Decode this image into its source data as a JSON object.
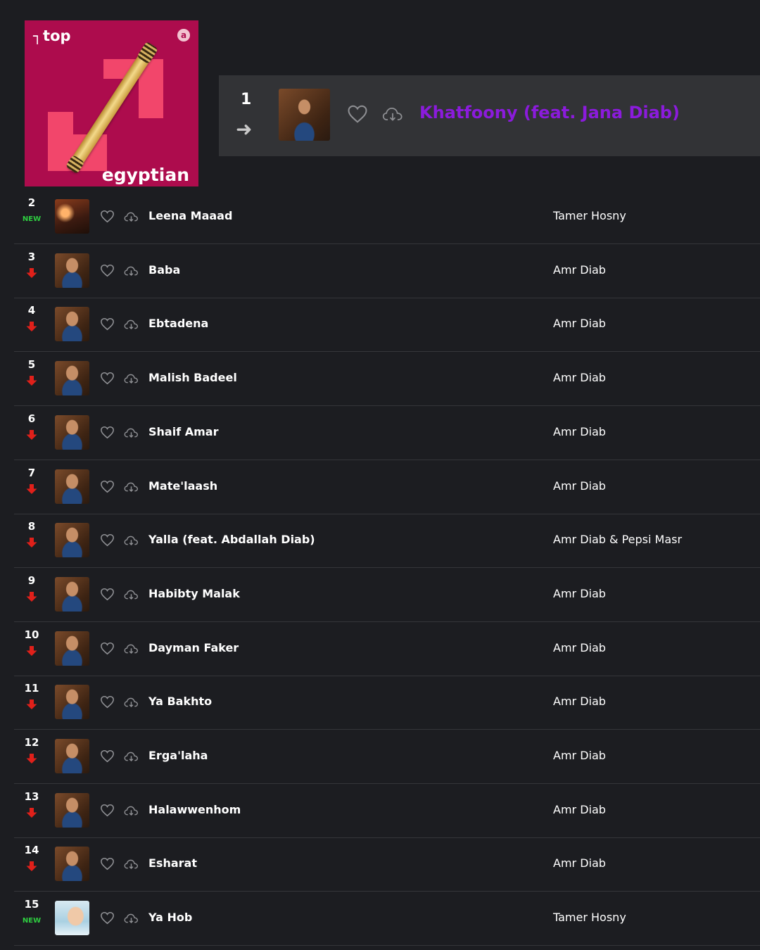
{
  "cover": {
    "brand": "top",
    "subtitle": "egyptian"
  },
  "featured": {
    "rank": "1",
    "trend": "same",
    "title": "Khatfoony (feat. Jana Diab)",
    "title_color": "#8b1bdc"
  },
  "tracks": [
    {
      "rank": "2",
      "status": "NEW",
      "title": "Leena Maaad",
      "artist": "Tamer Hosny"
    },
    {
      "rank": "3",
      "status": "down",
      "title": "Baba",
      "artist": "Amr Diab"
    },
    {
      "rank": "4",
      "status": "down",
      "title": "Ebtadena",
      "artist": "Amr Diab"
    },
    {
      "rank": "5",
      "status": "down",
      "title": "Malish Badeel",
      "artist": "Amr Diab"
    },
    {
      "rank": "6",
      "status": "down",
      "title": "Shaif Amar",
      "artist": "Amr Diab"
    },
    {
      "rank": "7",
      "status": "down",
      "title": "Mate'laash",
      "artist": "Amr Diab"
    },
    {
      "rank": "8",
      "status": "down",
      "title": "Yalla (feat. Abdallah Diab)",
      "artist": "Amr Diab & Pepsi Masr"
    },
    {
      "rank": "9",
      "status": "down",
      "title": "Habibty Malak",
      "artist": "Amr Diab"
    },
    {
      "rank": "10",
      "status": "down",
      "title": "Dayman Faker",
      "artist": "Amr Diab"
    },
    {
      "rank": "11",
      "status": "down",
      "title": "Ya Bakhto",
      "artist": "Amr Diab"
    },
    {
      "rank": "12",
      "status": "down",
      "title": "Erga'laha",
      "artist": "Amr Diab"
    },
    {
      "rank": "13",
      "status": "down",
      "title": "Halawwenhom",
      "artist": "Amr Diab"
    },
    {
      "rank": "14",
      "status": "down",
      "title": "Esharat",
      "artist": "Amr Diab"
    },
    {
      "rank": "15",
      "status": "NEW",
      "title": "Ya Hob",
      "artist": "Tamer Hosny"
    }
  ],
  "colors": {
    "background": "#1c1d21",
    "new_badge": "#2ecc40",
    "down_arrow": "#e0201a",
    "cover": "#ad0c4d"
  },
  "icons": {
    "like": "heart-icon",
    "download": "cloud-download-icon",
    "trend_down": "arrow-down-icon",
    "trend_same": "arrow-right-icon"
  }
}
